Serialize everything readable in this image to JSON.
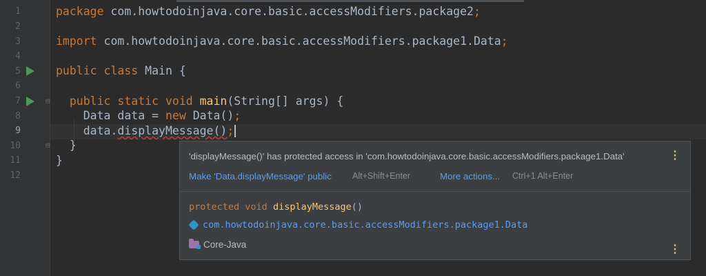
{
  "editor": {
    "line_numbers": [
      "1",
      "2",
      "3",
      "4",
      "5",
      "6",
      "7",
      "8",
      "9",
      "10",
      "11",
      "12"
    ],
    "active_line": "9",
    "code": {
      "l1_kw": "package",
      "l1_rest": " com.howtodoinjava.core.basic.accessModifiers.package2",
      "l1_semi": ";",
      "l3_kw": "import",
      "l3_rest": " com.howtodoinjava.core.basic.accessModifiers.package1.Data",
      "l3_semi": ";",
      "l5_kw": "public class",
      "l5_rest": " Main {",
      "l7_indent": "  ",
      "l7_kw": "public static void",
      "l7_space": " ",
      "l7_fn": "main",
      "l7_rest": "(String[] args) {",
      "l8_lead": "    Data data = ",
      "l8_kw": "new",
      "l8_rest": " Data()",
      "l8_semi": ";",
      "l9_lead": "    data.",
      "l9_err": "displayMessage()",
      "l9_semi": ";",
      "l10": "  }",
      "l11": "}"
    }
  },
  "popup": {
    "message": "'displayMessage()' has protected access in 'com.howtodoinjava.core.basic.accessModifiers.package1.Data'",
    "fix_action": "Make 'Data.displayMessage' public",
    "fix_shortcut": "Alt+Shift+Enter",
    "more_actions": "More actions...",
    "more_shortcut": "Ctrl+1 Alt+Enter",
    "decl_kw": "protected void",
    "decl_fn": "displayMessage",
    "decl_rest": "()",
    "package_path": "com.howtodoinjava.core.basic.accessModifiers.package1.Data",
    "module_name": "Core-Java",
    "menu_icon": "⋮"
  },
  "colors": {
    "background": "#2b2b2b",
    "keyword": "#cc7832",
    "function": "#ffc66d",
    "link": "#589df6",
    "run_icon": "#499c54"
  }
}
